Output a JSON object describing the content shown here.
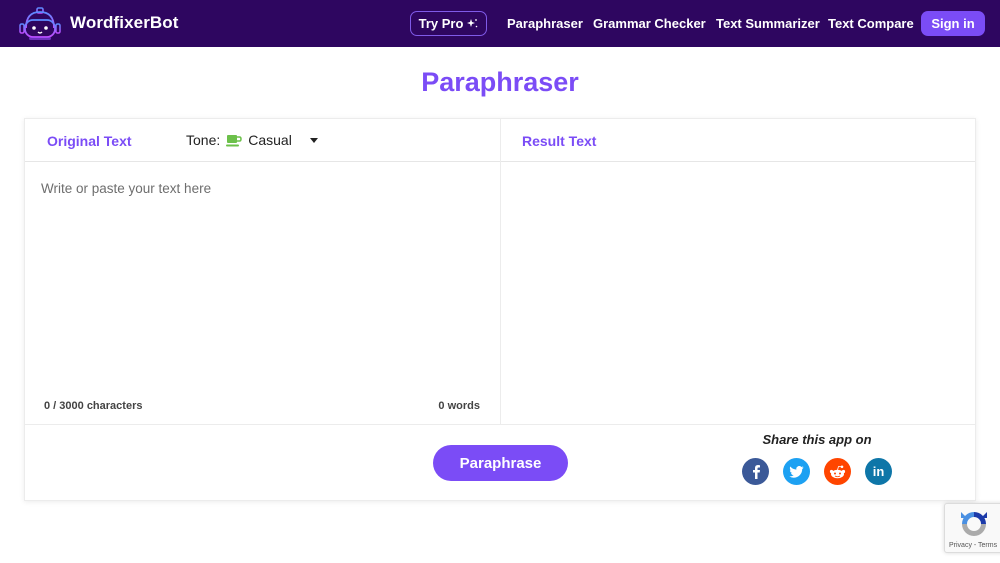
{
  "nav": {
    "brand": "WordfixerBot",
    "try_pro": "Try Pro",
    "links": [
      "Paraphraser",
      "Grammar Checker",
      "Text Summarizer",
      "Text Compare"
    ],
    "sign_in": "Sign in"
  },
  "page": {
    "title": "Paraphraser"
  },
  "editor": {
    "original_label": "Original Text",
    "tone_label": "Tone:",
    "tone_value": "Casual",
    "placeholder": "Write or paste your text here",
    "char_count": "0 / 3000 characters",
    "word_count": "0 words",
    "result_label": "Result Text"
  },
  "actions": {
    "paraphrase": "Paraphrase"
  },
  "share": {
    "label": "Share this app on",
    "networks": [
      {
        "name": "facebook",
        "glyph": "f",
        "color": "#3b5998"
      },
      {
        "name": "twitter",
        "glyph": "t",
        "color": "#1da1f2"
      },
      {
        "name": "reddit",
        "glyph": "r",
        "color": "#ff4500"
      },
      {
        "name": "linkedin",
        "glyph": "in",
        "color": "#0e76a8"
      }
    ]
  },
  "recaptcha": {
    "text": "Privacy - Terms"
  },
  "colors": {
    "nav_bg": "#2e0660",
    "accent": "#7b4cf6"
  }
}
